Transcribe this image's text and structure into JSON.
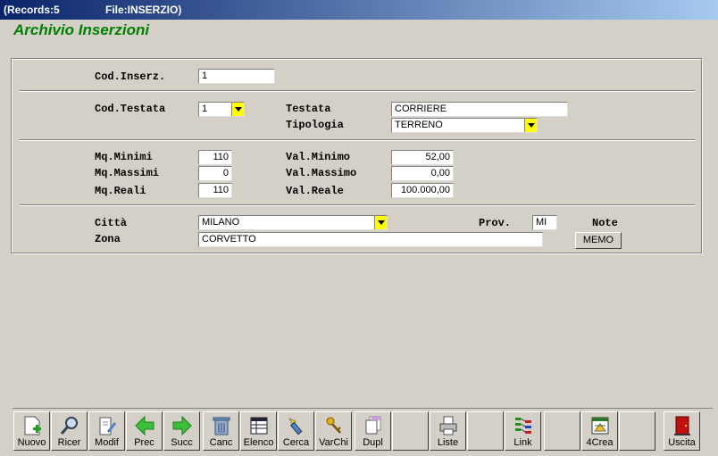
{
  "window": {
    "records": "(Records:5",
    "file": "File:INSERZIO)"
  },
  "app_title": "Archivio Inserzioni",
  "form": {
    "cod_inserz": {
      "label": "Cod.Inserz.",
      "value": "1"
    },
    "cod_testata": {
      "label": "Cod.Testata",
      "value": "1"
    },
    "testata": {
      "label": "Testata",
      "value": "CORRIERE"
    },
    "tipologia": {
      "label": "Tipologia",
      "value": "TERRENO"
    },
    "mq_minimi": {
      "label": "Mq.Minimi",
      "value": "110"
    },
    "mq_massimi": {
      "label": "Mq.Massimi",
      "value": "0"
    },
    "mq_reali": {
      "label": "Mq.Reali",
      "value": "110"
    },
    "val_minimo": {
      "label": "Val.Minimo",
      "value": "52,00"
    },
    "val_massimo": {
      "label": "Val.Massimo",
      "value": "0,00"
    },
    "val_reale": {
      "label": "Val.Reale",
      "value": "100.000,00"
    },
    "citta": {
      "label": "Città",
      "value": "MILANO"
    },
    "prov": {
      "label": "Prov.",
      "value": "MI"
    },
    "note": {
      "label": "Note",
      "button": "MEMO"
    },
    "zona": {
      "label": "Zona",
      "value": "CORVETTO"
    }
  },
  "toolbar": {
    "nuovo": "Nuovo",
    "ricer": "Ricer",
    "modif": "Modif",
    "prec": "Prec",
    "succ": "Succ",
    "canc": "Canc",
    "elenco": "Elenco",
    "cerca": "Cerca",
    "varchi": "VarChi",
    "dupl": "Dupl",
    "liste": "Liste",
    "link": "Link",
    "crea": "4Crea",
    "uscita": "Uscita"
  }
}
